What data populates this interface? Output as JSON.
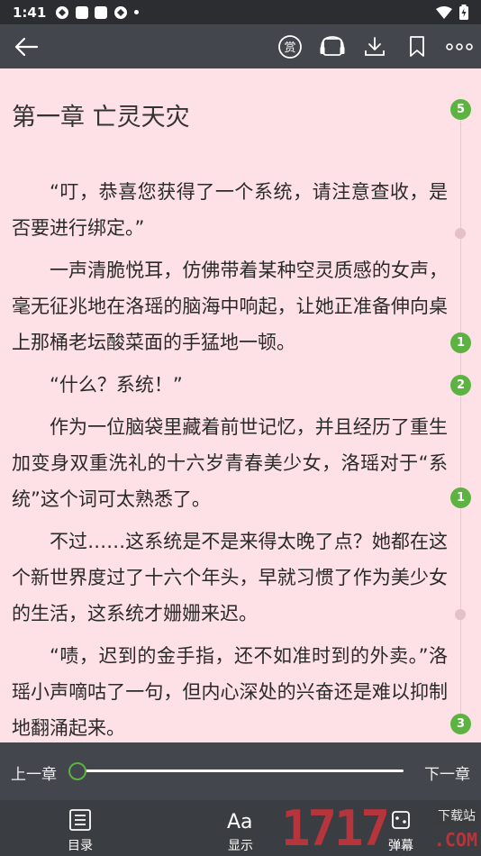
{
  "status": {
    "time": "1:41"
  },
  "chapter": {
    "title": "第一章 亡灵天灾",
    "paragraphs": [
      "“叮，恭喜您获得了一个系统，请注意查收，是否要进行绑定。”",
      "一声清脆悦耳，仿佛带着某种空灵质感的女声，毫无征兆地在洛瑶的脑海中响起，让她正准备伸向桌上那桶老坛酸菜面的手猛地一顿。",
      "“什么？系统！”",
      "作为一位脑袋里藏着前世记忆，并且经历了重生加变身双重洗礼的十六岁青春美少女，洛瑶对于“系统”这个词可太熟悉了。",
      "不过……这系统是不是来得太晚了点？她都在这个新世界度过了十六个年头，早就习惯了作为美少女的生活，这系统才姗姗来迟。",
      "“啧，迟到的金手指，还不如准时到的外卖。”洛瑶小声嘀咕了一句，但内心深处的兴奋还是难以抑制地翻涌起来。"
    ]
  },
  "comment_badges": [
    "5",
    "1",
    "2",
    "1",
    "3"
  ],
  "chapter_nav": {
    "prev": "上一章",
    "next": "下一章",
    "progress": 0
  },
  "tabs": [
    {
      "label": "目录",
      "icon": "list-icon"
    },
    {
      "label": "显示",
      "icon": "font-size-icon"
    },
    {
      "label": "弹幕",
      "icon": "danmaku-icon"
    }
  ],
  "watermark": {
    "digits": "1717",
    "tag": "下载站",
    "domain": ".COM"
  },
  "colors": {
    "accent": "#5cb342",
    "reader_bg": "#fde1e6",
    "bar": "#43464c"
  }
}
